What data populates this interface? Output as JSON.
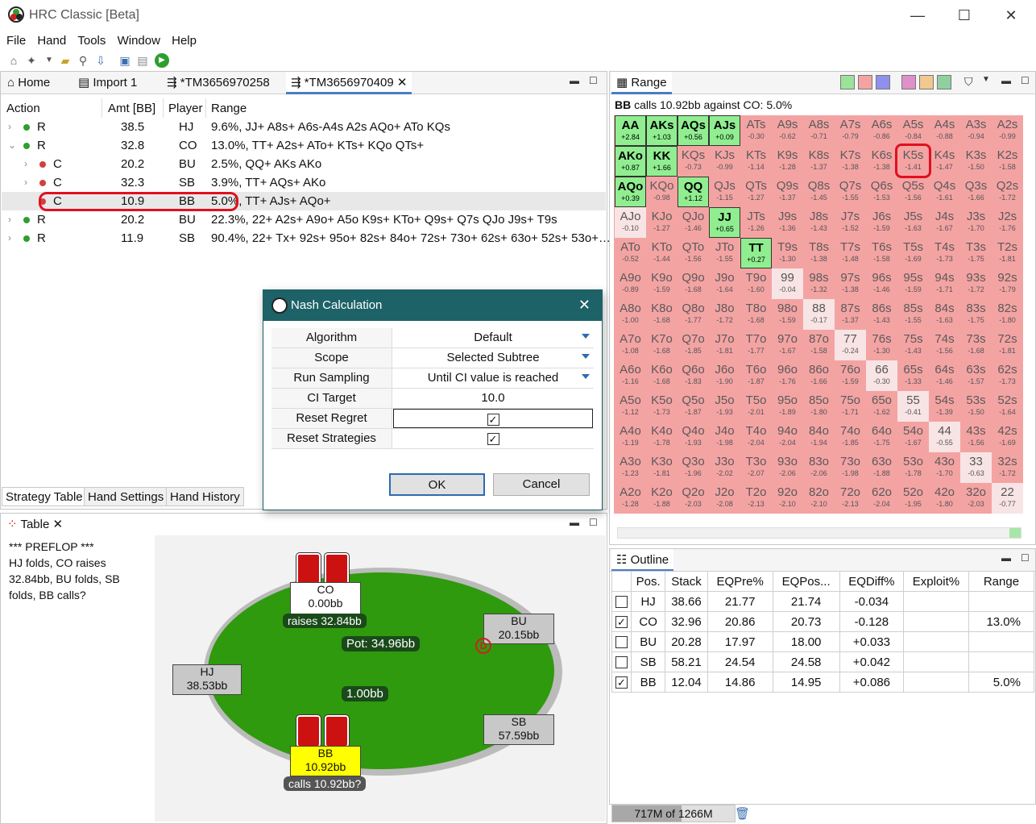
{
  "app": {
    "title": "HRC Classic [Beta]",
    "minimize": "—",
    "maximize": "☐",
    "close": "✕"
  },
  "menu": [
    "File",
    "Hand",
    "Tools",
    "Window",
    "Help"
  ],
  "tabs": {
    "home": "Home",
    "import": "Import 1",
    "tm1": "*TM3656970258",
    "tm2": "*TM3656970409"
  },
  "strategy": {
    "headers": {
      "action": "Action",
      "amt": "Amt [BB]",
      "player": "Player",
      "range": "Range"
    },
    "rows": [
      {
        "caret": "›",
        "dot": "#2e9e2e",
        "action": "R",
        "amt": "38.5",
        "player": "HJ",
        "range": "9.6%, JJ+ A8s+ A6s-A4s A2s AQo+ ATo KQs"
      },
      {
        "caret": "⌄",
        "dot": "#2e9e2e",
        "action": "R",
        "amt": "32.8",
        "player": "CO",
        "range": "13.0%, TT+ A2s+ ATo+ KTs+ KQo QTs+"
      },
      {
        "caret": "›",
        "dot": "#d04040",
        "action": "C",
        "amt": "20.2",
        "player": "BU",
        "range": "2.5%, QQ+ AKs AKo"
      },
      {
        "caret": "›",
        "dot": "#d04040",
        "action": "C",
        "amt": "32.3",
        "player": "SB",
        "range": "3.9%, TT+ AQs+ AKo"
      },
      {
        "caret": "",
        "dot": "#d04040",
        "action": "C",
        "amt": "10.9",
        "player": "BB",
        "range": "5.0%, TT+ AJs+ AQo+"
      },
      {
        "caret": "›",
        "dot": "#2e9e2e",
        "action": "R",
        "amt": "20.2",
        "player": "BU",
        "range": "22.3%, 22+ A2s+ A9o+ A5o K9s+ KTo+ Q9s+ Q7s QJo J9s+ T9s"
      },
      {
        "caret": "›",
        "dot": "#2e9e2e",
        "action": "R",
        "amt": "11.9",
        "player": "SB",
        "range": "90.4%, 22+ Tx+ 92s+ 95o+ 82s+ 84o+ 72s+ 73o+ 62s+ 63o+ 52s+ 53o+…"
      }
    ],
    "bottom_tabs": [
      "Strategy Table",
      "Hand Settings",
      "Hand History"
    ]
  },
  "range_panel": {
    "tab": "Range",
    "caption_bold": "BB",
    "caption": " calls 10.92bb against CO: 5.0%",
    "ranks": [
      "A",
      "K",
      "Q",
      "J",
      "T",
      "9",
      "8",
      "7",
      "6",
      "5",
      "4",
      "3",
      "2"
    ],
    "values": [
      [
        "+2.84",
        "+1.03",
        "+0.56",
        "+0.09",
        "-0.30",
        "-0.62",
        "-0.71",
        "-0.79",
        "-0.86",
        "-0.84",
        "-0.88",
        "-0.94",
        "-0.99"
      ],
      [
        "+0.87",
        "+1.66",
        "-0.73",
        "-0.99",
        "-1.14",
        "-1.28",
        "-1.37",
        "-1.38",
        "-1.38",
        "-1.41",
        "-1.47",
        "-1.50",
        "-1.58"
      ],
      [
        "+0.39",
        "-0.98",
        "+1.12",
        "-1.15",
        "-1.27",
        "-1.37",
        "-1.45",
        "-1.55",
        "-1.53",
        "-1.56",
        "-1.61",
        "-1.66",
        "-1.72"
      ],
      [
        "-0.10",
        "-1.27",
        "-1.46",
        "+0.65",
        "-1.26",
        "-1.36",
        "-1.43",
        "-1.52",
        "-1.59",
        "-1.63",
        "-1.67",
        "-1.70",
        "-1.76"
      ],
      [
        "-0.52",
        "-1.44",
        "-1.56",
        "-1.55",
        "+0.27",
        "-1.30",
        "-1.38",
        "-1.48",
        "-1.58",
        "-1.69",
        "-1.73",
        "-1.75",
        "-1.81"
      ],
      [
        "-0.89",
        "-1.59",
        "-1.68",
        "-1.64",
        "-1.60",
        "-0.04",
        "-1.32",
        "-1.38",
        "-1.46",
        "-1.59",
        "-1.71",
        "-1.72",
        "-1.79"
      ],
      [
        "-1.00",
        "-1.68",
        "-1.77",
        "-1.72",
        "-1.68",
        "-1.59",
        "-0.17",
        "-1.37",
        "-1.43",
        "-1.55",
        "-1.63",
        "-1.75",
        "-1.80"
      ],
      [
        "-1.08",
        "-1.68",
        "-1.85",
        "-1.81",
        "-1.77",
        "-1.67",
        "-1.58",
        "-0.24",
        "-1.30",
        "-1.43",
        "-1.56",
        "-1.68",
        "-1.81"
      ],
      [
        "-1.16",
        "-1.68",
        "-1.83",
        "-1.90",
        "-1.87",
        "-1.76",
        "-1.66",
        "-1.59",
        "-0.30",
        "-1.33",
        "-1.46",
        "-1.57",
        "-1.73"
      ],
      [
        "-1.12",
        "-1.73",
        "-1.87",
        "-1.93",
        "-2.01",
        "-1.89",
        "-1.80",
        "-1.71",
        "-1.62",
        "-0.41",
        "-1.39",
        "-1.50",
        "-1.64"
      ],
      [
        "-1.19",
        "-1.78",
        "-1.93",
        "-1.98",
        "-2.04",
        "-2.04",
        "-1.94",
        "-1.85",
        "-1.75",
        "-1.67",
        "-0.55",
        "-1.56",
        "-1.69"
      ],
      [
        "-1.23",
        "-1.81",
        "-1.96",
        "-2.02",
        "-2.07",
        "-2.06",
        "-2.06",
        "-1.98",
        "-1.88",
        "-1.78",
        "-1.70",
        "-0.63",
        "-1.72"
      ],
      [
        "-1.28",
        "-1.88",
        "-2.03",
        "-2.08",
        "-2.13",
        "-2.10",
        "-2.10",
        "-2.13",
        "-2.04",
        "-1.95",
        "-1.80",
        "-2.03",
        "-0.77"
      ]
    ],
    "call_hands": [
      "AA",
      "AKs",
      "AQs",
      "AJs",
      "AKo",
      "KK",
      "AQo",
      "QQ",
      "JJ",
      "TT"
    ],
    "mixed_hands": [
      "AJo",
      "99",
      "88",
      "77",
      "66",
      "55",
      "44",
      "33",
      "22"
    ],
    "highlighted_hand": "K5s"
  },
  "outline": {
    "tab": "Outline",
    "headers": [
      "Pos.",
      "Stack",
      "EQPre%",
      "EQPos...",
      "EQDiff%",
      "Exploit%",
      "Range"
    ],
    "rows": [
      {
        "checked": false,
        "pos": "HJ",
        "stack": "38.66",
        "eqpre": "21.77",
        "eqpost": "21.74",
        "eqdiff": "-0.034",
        "exploit": "",
        "range": ""
      },
      {
        "checked": true,
        "pos": "CO",
        "stack": "32.96",
        "eqpre": "20.86",
        "eqpost": "20.73",
        "eqdiff": "-0.128",
        "exploit": "",
        "range": "13.0%"
      },
      {
        "checked": false,
        "pos": "BU",
        "stack": "20.28",
        "eqpre": "17.97",
        "eqpost": "18.00",
        "eqdiff": "+0.033",
        "exploit": "",
        "range": ""
      },
      {
        "checked": false,
        "pos": "SB",
        "stack": "58.21",
        "eqpre": "24.54",
        "eqpost": "24.58",
        "eqdiff": "+0.042",
        "exploit": "",
        "range": ""
      },
      {
        "checked": true,
        "pos": "BB",
        "stack": "12.04",
        "eqpre": "14.86",
        "eqpost": "14.95",
        "eqdiff": "+0.086",
        "exploit": "",
        "range": "5.0%"
      }
    ]
  },
  "table_panel": {
    "tab": "Table",
    "history": "*** PREFLOP ***\nHJ folds, CO raises\n32.84bb, BU folds, SB\nfolds, BB calls?",
    "co": {
      "name": "CO",
      "stack": "0.00bb",
      "action": "raises 32.84bb"
    },
    "bu": {
      "name": "BU",
      "stack": "20.15bb"
    },
    "hj": {
      "name": "HJ",
      "stack": "38.53bb"
    },
    "sb": {
      "name": "SB",
      "stack": "57.59bb"
    },
    "bb": {
      "name": "BB",
      "stack": "10.92bb",
      "action": "calls 10.92bb?"
    },
    "pot": "Pot:   34.96bb",
    "center": "1.00bb",
    "dealer": "D"
  },
  "dialog": {
    "title": "Nash Calculation",
    "rows": [
      {
        "label": "Algorithm",
        "value": "Default",
        "type": "dropdown"
      },
      {
        "label": "Scope",
        "value": "Selected Subtree",
        "type": "dropdown"
      },
      {
        "label": "Run Sampling",
        "value": "Until CI value is reached",
        "type": "dropdown"
      },
      {
        "label": "CI Target",
        "value": "10.0",
        "type": "text"
      },
      {
        "label": "Reset Regret",
        "value": "✓",
        "type": "checkbox"
      },
      {
        "label": "Reset Strategies",
        "value": "✓",
        "type": "checkbox"
      }
    ],
    "ok": "OK",
    "cancel": "Cancel"
  },
  "status": {
    "memory": "717M of 1266M",
    "memory_used_fraction": 0.566
  },
  "colors": {
    "call": "#90ee90",
    "fold": "#f4a3a3",
    "mixed": "#f8e4e4",
    "highlight": "#e01020",
    "dialog_title": "#1d6267"
  }
}
